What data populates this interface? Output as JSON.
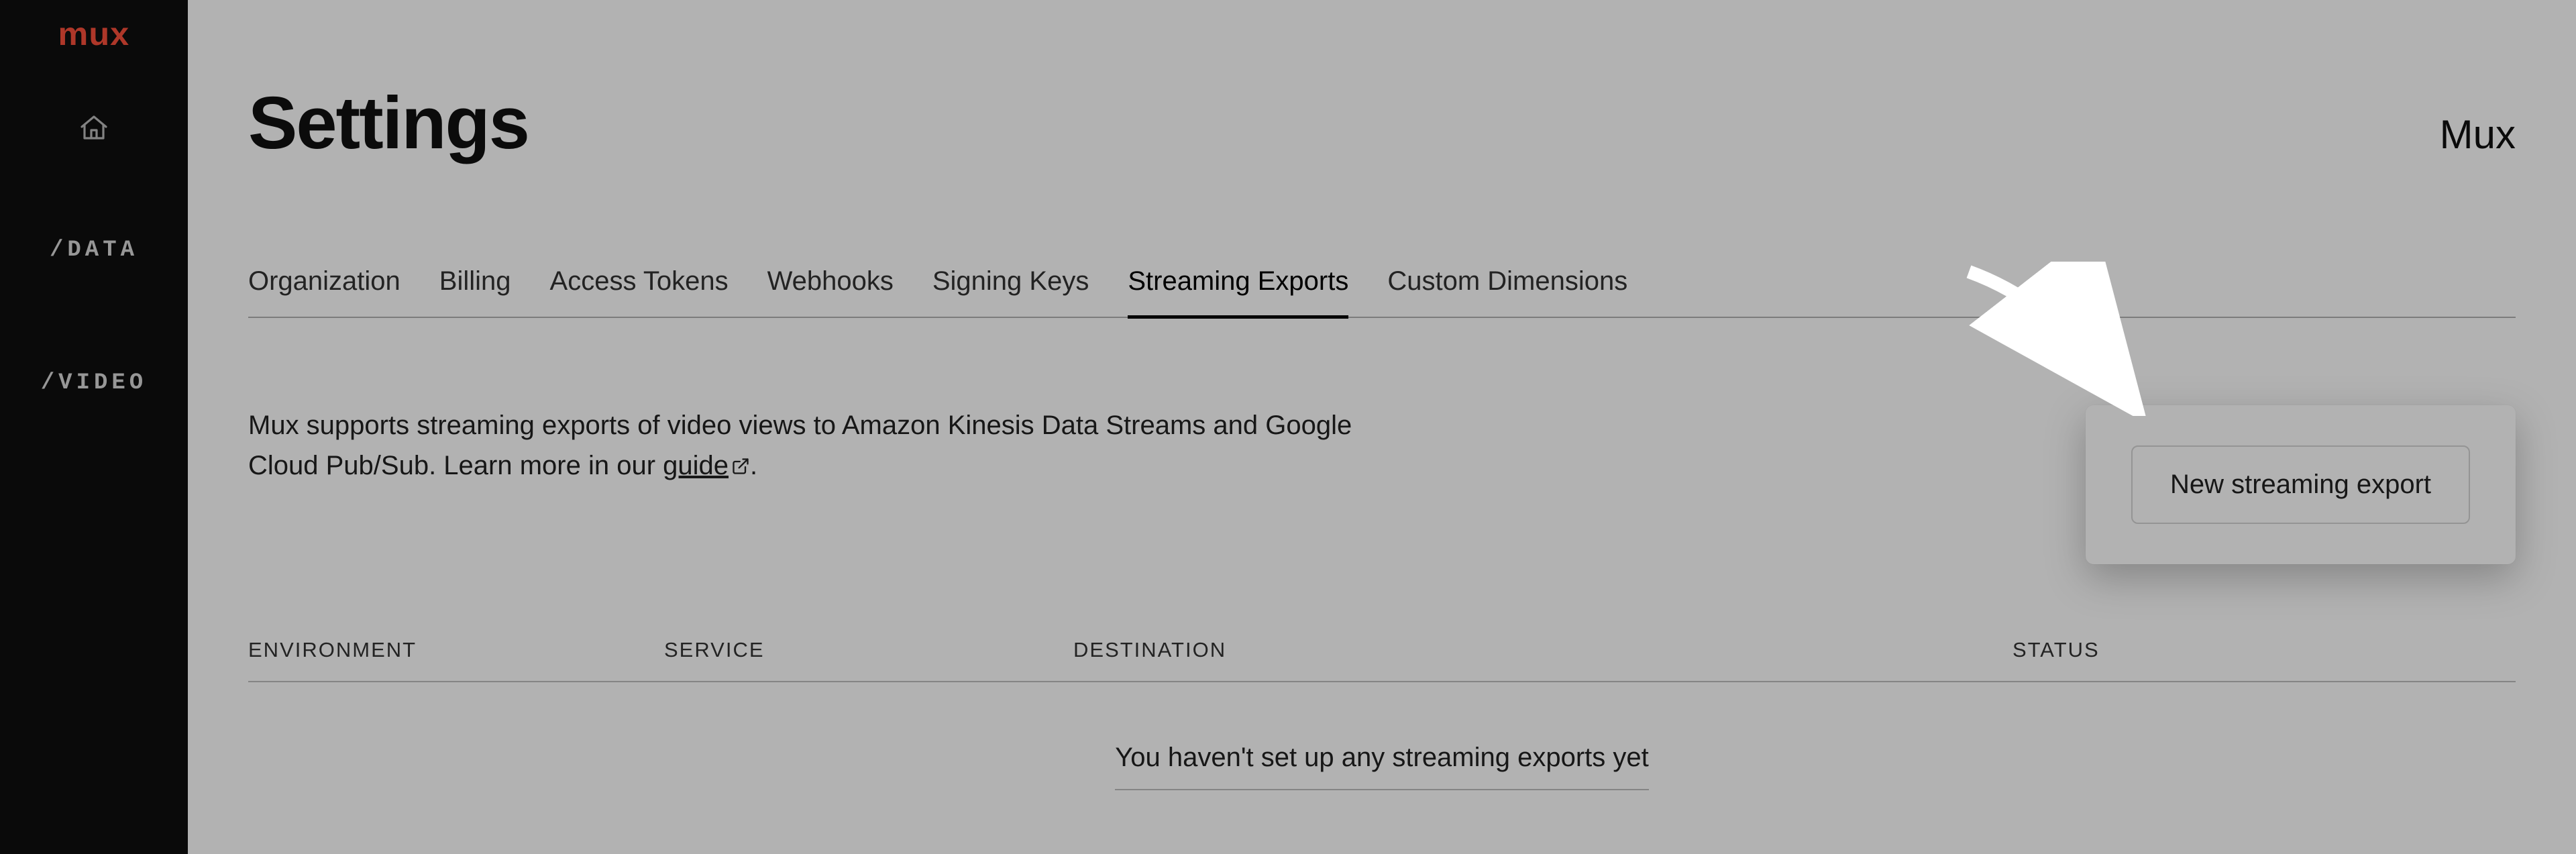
{
  "sidebar": {
    "logo_text": "mux",
    "items": [
      {
        "label": "/DATA"
      },
      {
        "label": "/VIDEO"
      }
    ]
  },
  "header": {
    "title": "Settings",
    "org_name": "Mux"
  },
  "tabs": [
    {
      "label": "Organization",
      "active": false
    },
    {
      "label": "Billing",
      "active": false
    },
    {
      "label": "Access Tokens",
      "active": false
    },
    {
      "label": "Webhooks",
      "active": false
    },
    {
      "label": "Signing Keys",
      "active": false
    },
    {
      "label": "Streaming Exports",
      "active": true
    },
    {
      "label": "Custom Dimensions",
      "active": false
    }
  ],
  "description": {
    "text_before": "Mux supports streaming exports of video views to Amazon Kinesis Data Streams and Google Cloud Pub/Sub. Learn more in our ",
    "link_text": "guide",
    "text_after": "."
  },
  "actions": {
    "new_export": "New streaming export"
  },
  "table": {
    "columns": {
      "environment": "ENVIRONMENT",
      "service": "SERVICE",
      "destination": "DESTINATION",
      "status": "STATUS"
    },
    "empty_message": "You haven't set up any streaming exports yet"
  }
}
